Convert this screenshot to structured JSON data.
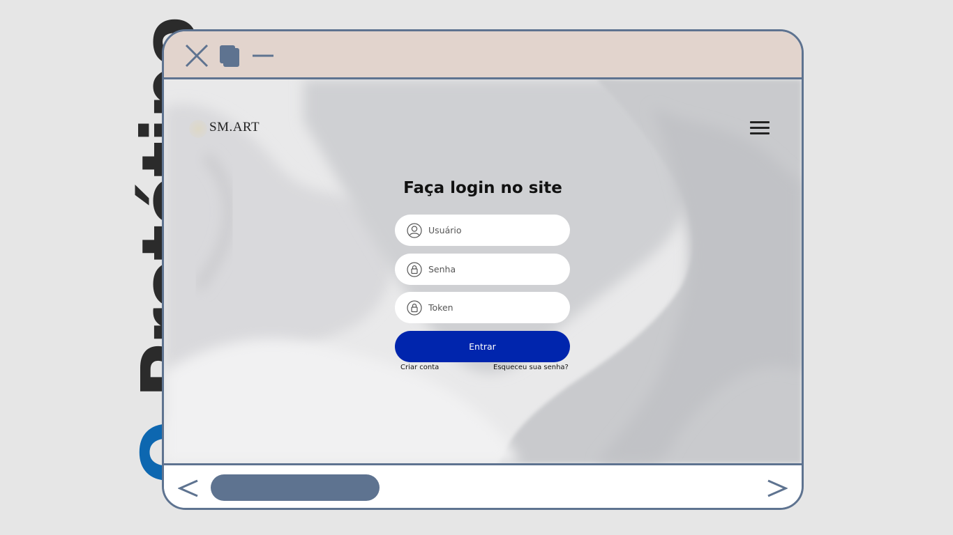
{
  "side_title": {
    "first": "O",
    "rest": " Protótipo"
  },
  "brand": {
    "name": "SM.ART"
  },
  "login": {
    "title": "Faça login no site",
    "username_placeholder": "Usuário",
    "password_placeholder": "Senha",
    "token_placeholder": "Token",
    "submit_label": "Entrar",
    "create_account_label": "Criar conta",
    "forgot_password_label": "Esqueceu sua senha?"
  },
  "colors": {
    "frame": "#5e7390",
    "titlebar": "#e2d4cd",
    "primary_button": "#0025ad",
    "side_title_accent": "#0d67b0",
    "side_title_text": "#2b2b2b"
  },
  "icons": {
    "close": "close-icon",
    "restore": "restore-icon",
    "minimize": "minimize-icon",
    "user": "user-icon",
    "lock": "lock-icon",
    "menu": "menu-icon",
    "prev": "chevron-left-icon",
    "next": "chevron-right-icon"
  }
}
